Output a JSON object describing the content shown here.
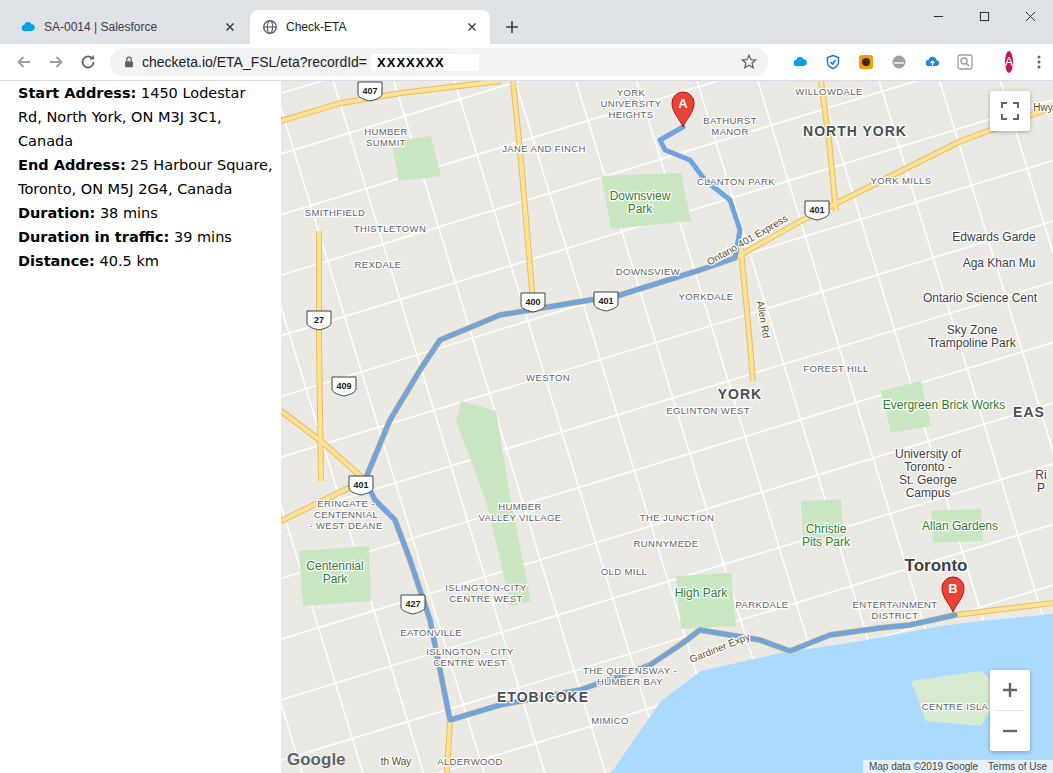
{
  "tabs": [
    {
      "label": "SA-0014 | Salesforce",
      "selected": false
    },
    {
      "label": "Check-ETA",
      "selected": true
    }
  ],
  "address_bar": {
    "url": "checketa.io/ETA_FSL/eta?recordId=",
    "redacted": "XXXXXXX"
  },
  "profile": {
    "initial": "A"
  },
  "trip": [
    {
      "label": "Start Address:",
      "value": "1450 Lodestar Rd, North York, ON M3J 3C1, Canada"
    },
    {
      "label": "End Address:",
      "value": "25 Harbour Square, Toronto, ON M5J 2G4, Canada"
    },
    {
      "label": "Duration:",
      "value": "38 mins"
    },
    {
      "label": "Duration in traffic:",
      "value": "39 mins"
    },
    {
      "label": "Distance:",
      "value": "40.5 km"
    }
  ],
  "map": {
    "labels": [
      {
        "lines": [
          "WILLOWDALE"
        ],
        "kind": "area"
      },
      {
        "lines": [
          "YORK",
          "UNIVERSITY",
          "HEIGHTS"
        ],
        "kind": "area"
      },
      {
        "lines": [
          "BATHURST",
          "MANOR"
        ],
        "kind": "area"
      },
      {
        "lines": [
          "NORTH YORK"
        ],
        "kind": "district"
      },
      {
        "lines": [
          "HUMBER",
          "SUMMIT"
        ],
        "kind": "area"
      },
      {
        "lines": [
          "JANE AND FINCH"
        ],
        "kind": "area"
      },
      {
        "lines": [
          "Downsview",
          "Park"
        ],
        "kind": "park"
      },
      {
        "lines": [
          "CLANTON PARK"
        ],
        "kind": "area"
      },
      {
        "lines": [
          "YORK MILLS"
        ],
        "kind": "area"
      },
      {
        "lines": [
          "SMITHFIELD"
        ],
        "kind": "area"
      },
      {
        "lines": [
          "THISTLETOWN"
        ],
        "kind": "area"
      },
      {
        "lines": [
          "Edwards Garde"
        ],
        "kind": "poi"
      },
      {
        "lines": [
          "Aga Khan Mu"
        ],
        "kind": "poi"
      },
      {
        "lines": [
          "REXDALE"
        ],
        "kind": "area"
      },
      {
        "lines": [
          "DOWNSVIEW"
        ],
        "kind": "area"
      },
      {
        "lines": [
          "YORKDALE"
        ],
        "kind": "area"
      },
      {
        "lines": [
          "Ontario Science Cent"
        ],
        "kind": "poi"
      },
      {
        "lines": [
          "Sky Zone",
          "Trampoline Park"
        ],
        "kind": "poi"
      },
      {
        "lines": [
          "FOREST HILL"
        ],
        "kind": "area"
      },
      {
        "lines": [
          "WESTON"
        ],
        "kind": "area"
      },
      {
        "lines": [
          "YORK"
        ],
        "kind": "district"
      },
      {
        "lines": [
          "EGLINTON WEST"
        ],
        "kind": "area"
      },
      {
        "lines": [
          "Evergreen Brick Works"
        ],
        "kind": "park"
      },
      {
        "lines": [
          "EAS"
        ],
        "kind": "district"
      },
      {
        "lines": [
          "University of",
          "Toronto -",
          "St. George",
          "Campus"
        ],
        "kind": "poi"
      },
      {
        "lines": [
          "Ri",
          "P"
        ],
        "kind": "poi"
      },
      {
        "lines": [
          "HUMBER",
          "VALLEY VILLAGE"
        ],
        "kind": "area"
      },
      {
        "lines": [
          "ERINGATE -",
          "CENTENNIAL",
          "- WEST DEANE"
        ],
        "kind": "area"
      },
      {
        "lines": [
          "THE JUNCTION"
        ],
        "kind": "area"
      },
      {
        "lines": [
          "Allan Gardens"
        ],
        "kind": "park"
      },
      {
        "lines": [
          "Christie",
          "Pits Park"
        ],
        "kind": "park"
      },
      {
        "lines": [
          "Centennial",
          "Park"
        ],
        "kind": "park"
      },
      {
        "lines": [
          "RUNNYMEDE"
        ],
        "kind": "area"
      },
      {
        "lines": [
          "Toronto"
        ],
        "kind": "city"
      },
      {
        "lines": [
          "ISLINGTON-CITY",
          "CENTRE WEST"
        ],
        "kind": "area"
      },
      {
        "lines": [
          "OLD MILL"
        ],
        "kind": "area"
      },
      {
        "lines": [
          "High Park"
        ],
        "kind": "park"
      },
      {
        "lines": [
          "PARKDALE"
        ],
        "kind": "area"
      },
      {
        "lines": [
          "ENTERTAINMENT",
          "DISTRICT"
        ],
        "kind": "area"
      },
      {
        "lines": [
          "EATONVILLE"
        ],
        "kind": "area"
      },
      {
        "lines": [
          "ISLINGTON - CITY",
          "CENTRE WEST"
        ],
        "kind": "area"
      },
      {
        "lines": [
          "THE QUEENSWAY -",
          "HUMBER BAY"
        ],
        "kind": "area"
      },
      {
        "lines": [
          "ETOBICOKE"
        ],
        "kind": "district"
      },
      {
        "lines": [
          "MIMICO"
        ],
        "kind": "area"
      },
      {
        "lines": [
          "CENTRE ISLA"
        ],
        "kind": "area"
      },
      {
        "lines": [
          "ALDERWOOD"
        ],
        "kind": "area"
      },
      {
        "lines": [
          "th Way"
        ],
        "kind": "road"
      },
      {
        "lines": [
          "Ontario 401 Express"
        ],
        "kind": "road"
      },
      {
        "lines": [
          "Allen Rd"
        ],
        "kind": "road"
      },
      {
        "lines": [
          "Gardiner Expy"
        ],
        "kind": "road"
      },
      {
        "lines": [
          "Hwy"
        ],
        "kind": "road"
      }
    ],
    "shields": [
      {
        "label": "407"
      },
      {
        "label": "401"
      },
      {
        "label": "400"
      },
      {
        "label": "401"
      },
      {
        "label": "27"
      },
      {
        "label": "409"
      },
      {
        "label": "401"
      },
      {
        "label": "427"
      }
    ],
    "markers": [
      {
        "label": "A"
      },
      {
        "label": "B"
      }
    ],
    "logo": "Google",
    "attribution": "Map data ©2019 Google",
    "terms": "Terms of Use"
  }
}
